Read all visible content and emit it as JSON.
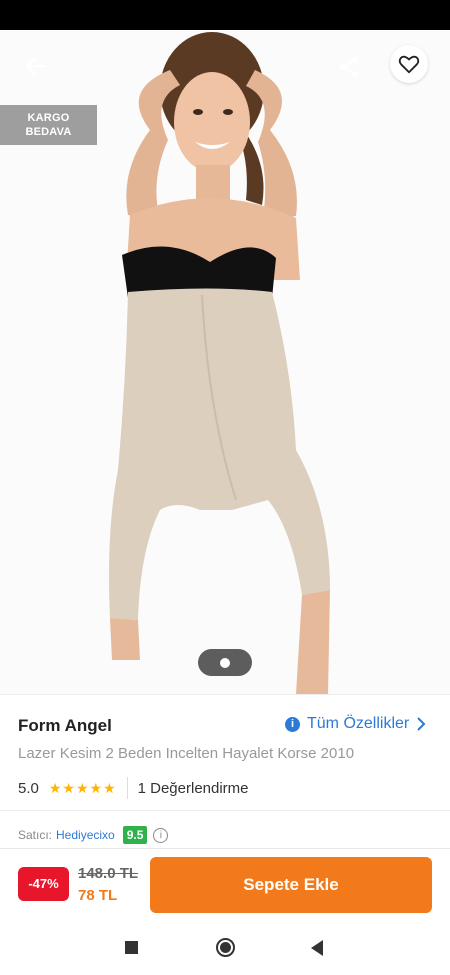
{
  "product_gallery": {
    "badge_line1": "KARGO",
    "badge_line2": "BEDAVA",
    "icons": {
      "back": "arrow-left-icon",
      "share": "share-icon",
      "favorite": "heart-outline-icon"
    },
    "image_alt": "product-photo"
  },
  "product": {
    "brand": "Form Angel",
    "all_features_label": "Tüm Özellikler",
    "title": "Lazer Kesim 2 Beden Incelten Hayalet Korse 2010",
    "rating": "5.0",
    "stars": "★★★★★",
    "review_count": "1 Değerlendirme"
  },
  "seller": {
    "label": "Satıcı:",
    "name": "Hediyecixo",
    "score": "9.5",
    "info_glyph": "i"
  },
  "purchase": {
    "discount": "-47%",
    "old_price": "148.0 TL",
    "new_price": "78 TL",
    "add_to_cart": "Sepete Ekle"
  },
  "colors": {
    "accent": "#f27a1a",
    "link": "#2d7ad6",
    "discount_red": "#e8162b",
    "score_green": "#2fb24c"
  }
}
